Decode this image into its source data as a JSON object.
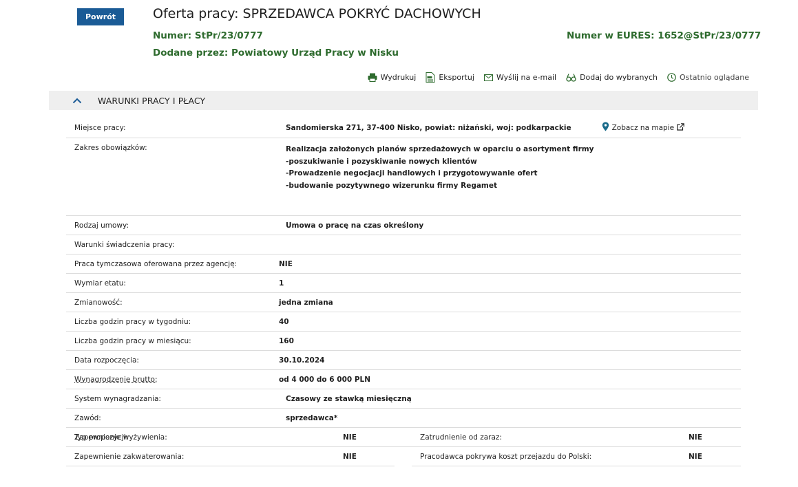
{
  "header": {
    "back_label": "Powrót",
    "title": "Oferta pracy: SPRZEDAWCA POKRYĆ DACHOWYCH",
    "number_label": "Numer:",
    "number_value": "StPr/23/0777",
    "eures_label": "Numer w EURES:",
    "eures_value": "1652@StPr/23/0777",
    "added_label": "Dodane przez:",
    "added_value": "Powiatowy Urząd Pracy w Nisku"
  },
  "actions": [
    {
      "label": "Wydrukuj",
      "icon": "printer-icon"
    },
    {
      "label": "Eksportuj",
      "icon": "export-pdf-icon"
    },
    {
      "label": "Wyślij na e-mail",
      "icon": "envelope-icon"
    },
    {
      "label": "Dodaj do wybranych",
      "icon": "glasses-icon"
    },
    {
      "label": "Ostatnio oglądane",
      "icon": "clock-icon"
    }
  ],
  "section": {
    "title": "WARUNKI PRACY I PŁACY"
  },
  "details": {
    "place_label": "Miejsce pracy:",
    "place_value": "Sandomierska 271, 37-400 Nisko, powiat: niżański, woj: podkarpackie",
    "map_link": "Zobacz na mapie",
    "duties_label": "Zakres obowiązków:",
    "duties_lines": [
      "Realizacja założonych planów sprzedażowych w oparciu o asortyment firmy",
      "-poszukiwanie i pozyskiwanie nowych klientów",
      "-Prowadzenie negocjacji handlowych i przygotowywanie ofert",
      "-budowanie pozytywnego wizerunku firmy Regamet"
    ],
    "rows": [
      {
        "label": "Rodzaj umowy:",
        "value": "Umowa o pracę na czas określony"
      },
      {
        "label": "Warunki świadczenia pracy:",
        "value": ""
      },
      {
        "label": "Praca tymczasowa oferowana przez agencję:",
        "value": "NIE"
      },
      {
        "label": "Wymiar etatu:",
        "value": "1"
      },
      {
        "label": "Zmianowość:",
        "value": "jedna zmiana"
      },
      {
        "label": "Liczba godzin pracy w tygodniu:",
        "value": "40"
      },
      {
        "label": "Liczba godzin pracy w miesiącu:",
        "value": "160"
      },
      {
        "label": "Data rozpoczęcia:",
        "value": "30.10.2024"
      },
      {
        "label": "Wynagrodzenie brutto:",
        "value": "od 4 000 do 6 000 PLN"
      },
      {
        "label": "System wynagradzania:",
        "value": "Czasowy ze stawką miesięczną"
      },
      {
        "label": "Zawód:",
        "value": "sprzedawca*"
      },
      {
        "label": "Typ propozycji:",
        "value": ""
      }
    ],
    "left_pairs": [
      {
        "label": "Zapewnienie wyżywienia:",
        "value": "NIE"
      },
      {
        "label": "Zapewnienie zakwaterowania:",
        "value": "NIE"
      }
    ],
    "right_pairs": [
      {
        "label": "Zatrudnienie od zaraz:",
        "value": "NIE"
      },
      {
        "label": "Pracodawca pokrywa koszt przejazdu do Polski:",
        "value": "NIE"
      }
    ]
  },
  "colors": {
    "accent_blue": "#1a5b96",
    "meta_green": "#2e6b2e",
    "section_bg": "#efefef"
  }
}
